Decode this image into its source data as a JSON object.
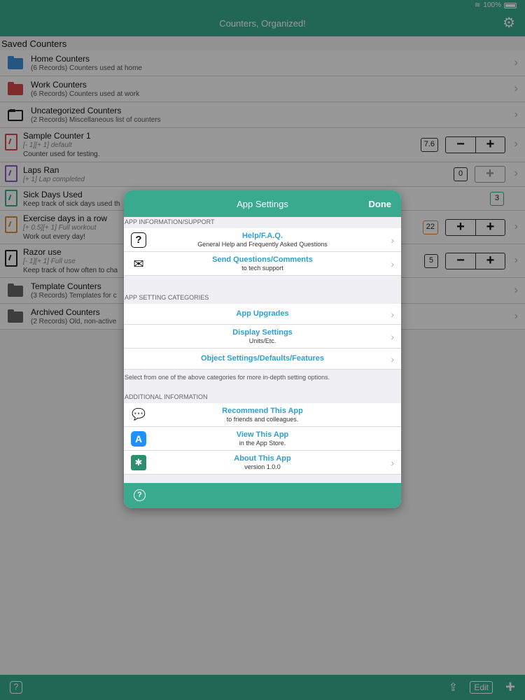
{
  "status": {
    "battery": "100%"
  },
  "nav": {
    "title": "Counters, Organized!",
    "gear_icon": "gear-icon"
  },
  "list": {
    "section_title": "Saved Counters",
    "folders_top": [
      {
        "title": "Home Counters",
        "sub": "(6 Records) Counters used at home",
        "color": "#3d8fd8"
      },
      {
        "title": "Work Counters",
        "sub": "(6 Records) Counters used at work",
        "color": "#d8484a"
      },
      {
        "title": "Uncategorized Counters",
        "sub": "(2 Records) Miscellaneous list of counters",
        "color": "#222222"
      }
    ],
    "counters": [
      {
        "title": "Sample Counter 1",
        "line1": "[- 1][+ 1] default",
        "line2": "Counter used for testing.",
        "value": "7.6",
        "icon_color": "#d8484a"
      },
      {
        "title": "Laps Ran",
        "line1": "[+ 1] Lap completed",
        "value": "0",
        "icon_color": "#8a5cc4"
      },
      {
        "title": "Sick Days Used",
        "line1": "Keep track of sick days used th",
        "value": "3",
        "icon_color": "#3aaa8e"
      },
      {
        "title": "Exercise days in a row",
        "line1": "[+ 0.5][+ 1] Full workout",
        "line2": "Work out every day!",
        "value": "22",
        "icon_color": "#e08a3a"
      },
      {
        "title": "Razor use",
        "line1": "[- 1][+ 1] Full use",
        "line2": "Keep track of how often to cha",
        "value": "5",
        "icon_color": "#222222"
      }
    ],
    "folders_bottom": [
      {
        "title": "Template Counters",
        "sub": "(3 Records) Templates for c"
      },
      {
        "title": "Archived Counters",
        "sub": "(2 Records) Old, non-active"
      }
    ]
  },
  "toolbar": {
    "edit_label": "Edit"
  },
  "modal": {
    "title": "App Settings",
    "done_label": "Done",
    "sections": {
      "info": "APP INFORMATION/SUPPORT",
      "categories": "APP SETTING CATEGORIES",
      "additional": "ADDITIONAL INFORMATION"
    },
    "info_rows": [
      {
        "label": "Help/F.A.Q.",
        "detail": "General Help and Frequently Asked Questions",
        "icon": "question-icon"
      },
      {
        "label": "Send Questions/Comments",
        "detail": "to tech support",
        "icon": "envelope-icon"
      }
    ],
    "category_rows": [
      {
        "label": "App Upgrades"
      },
      {
        "label": "Display Settings",
        "detail": "Units/Etc."
      },
      {
        "label": "Object Settings/Defaults/Features"
      }
    ],
    "categories_note": "Select from one of the above categories for more in-depth setting options.",
    "additional_rows": [
      {
        "label": "Recommend This App",
        "detail": "to friends and colleagues.",
        "icon": "chat-icon"
      },
      {
        "label": "View This App",
        "detail": "in the App Store.",
        "icon": "app-store-icon"
      },
      {
        "label": "About This App",
        "detail": "version 1.0.0",
        "icon": "app-logo-icon"
      }
    ]
  }
}
